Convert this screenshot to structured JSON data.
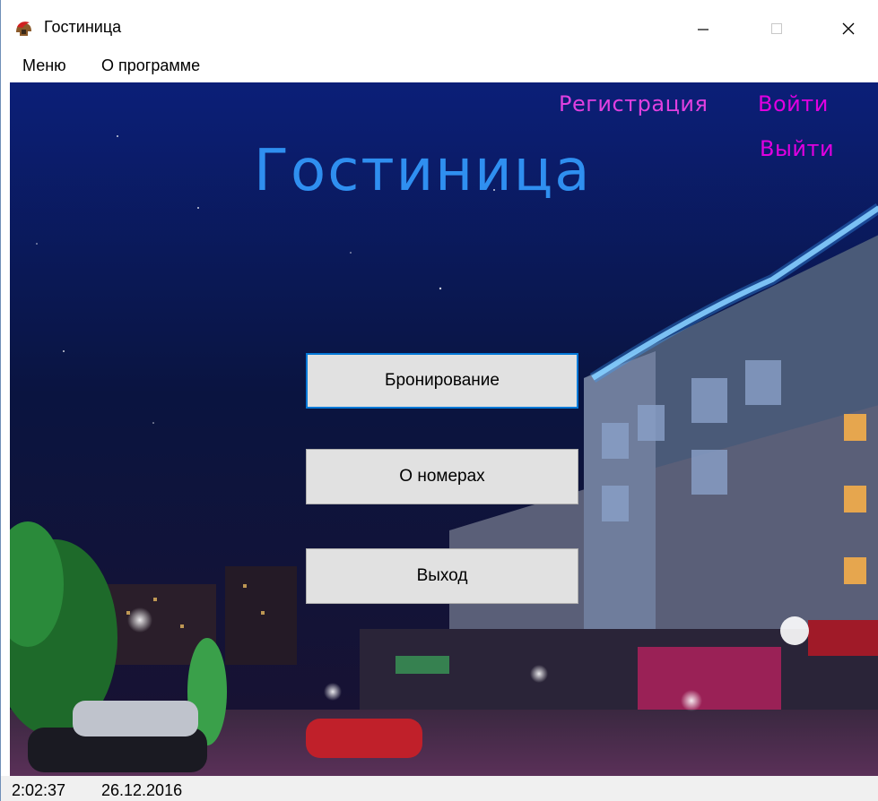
{
  "window": {
    "title": "Гостиница",
    "icon": "spartan-helmet-icon"
  },
  "menubar": {
    "items": [
      {
        "label": "Меню"
      },
      {
        "label": "О программе"
      }
    ]
  },
  "header": {
    "register_label": "Регистрация",
    "login_label": "Войти",
    "logout_label": "Выйти",
    "hero_title": "Гостиница"
  },
  "main": {
    "buttons": [
      {
        "label": "Бронирование"
      },
      {
        "label": "О номерах"
      },
      {
        "label": "Выход"
      }
    ]
  },
  "statusbar": {
    "time": "2:02:37",
    "date": "26.12.2016"
  },
  "colors": {
    "link_magenta": "#e000e0",
    "title_blue": "#2f8ff0",
    "focus_blue": "#0078d7"
  }
}
